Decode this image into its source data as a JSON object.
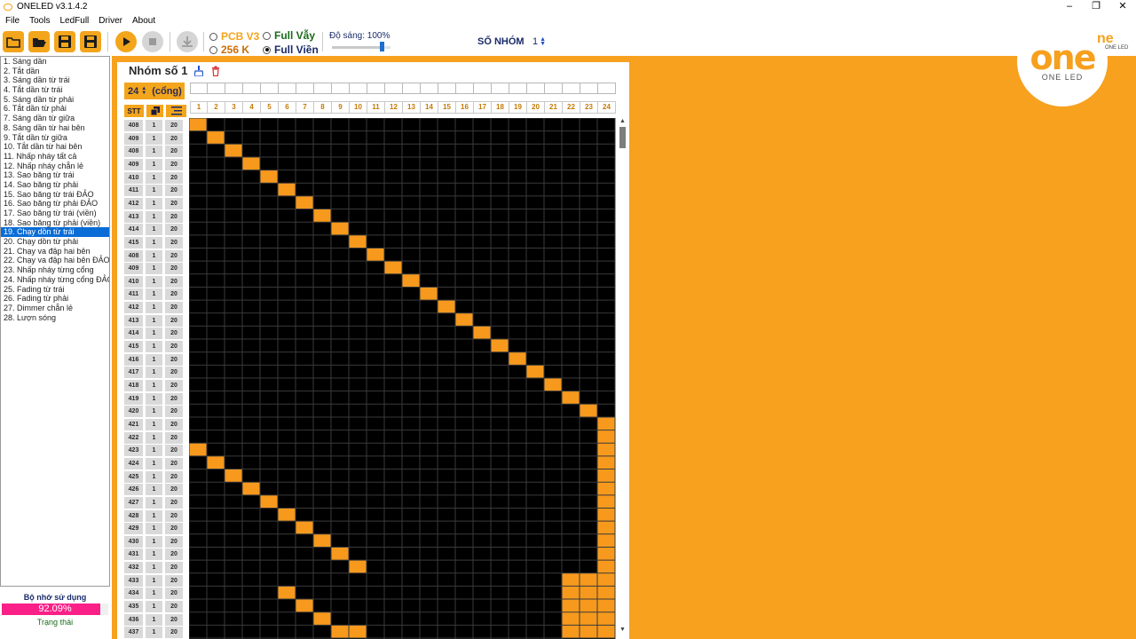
{
  "window": {
    "title": "ONELED v3.1.4.2",
    "controls": [
      "–",
      "❐",
      "✕"
    ]
  },
  "menu": [
    "File",
    "Tools",
    "LedFull",
    "Driver",
    "About"
  ],
  "toolbar": {
    "buttons": [
      "new-folder",
      "open-folder",
      "save",
      "save-as",
      "play",
      "stop",
      "download"
    ],
    "pcb_label": "PCB V3",
    "k256_label": "256 K",
    "full_vay_label": "Full Vẫy",
    "full_vien_label": "Full Viền",
    "selected_mode": "Full Viền",
    "brightness_label": "Độ sáng: 100%",
    "brightness_level": 0.85,
    "group_count_label": "SỐ NHÓM",
    "group_count_value": "1"
  },
  "effects": [
    "1.  Sáng dần",
    "2.  Tắt dần",
    "3.  Sáng dần từ trái",
    "4.  Tắt dần từ trái",
    "5.  Sáng dần từ phải",
    "6.  Tắt dần từ phải",
    "7.  Sáng dần từ giữa",
    "8.  Sáng dần từ hai bên",
    "9.  Tắt dần từ giữa",
    "10. Tắt dần từ hai bên",
    "11. Nhấp nháy tất cả",
    "12. Nhấp nháy chẵn lẻ",
    "13. Sao băng từ trái",
    "14. Sao băng từ phải",
    "15. Sao băng từ trái ĐẢO",
    "16. Sao băng từ phải ĐẢO",
    "17. Sao băng từ trái (viền)",
    "18. Sao băng từ phải (viền)",
    "19. Chạy dồn từ trái",
    "20. Chạy dồn từ phải",
    "21. Chạy va đập hai bên",
    "22. Chạy va đập hai bên ĐẢO",
    "23. Nhấp nháy từng cổng",
    "24. Nhấp nháy từng cổng ĐẢO",
    "25. Fading từ trái",
    "26. Fading từ phải",
    "27. Dimmer chẵn lẻ",
    "28. Lượn sóng"
  ],
  "selected_effect_index": 18,
  "memory": {
    "label": "Bộ nhớ sử dụng",
    "value": "92.09%",
    "fraction": 0.9209,
    "status_label": "Trạng thái"
  },
  "editor": {
    "group_title": "Nhóm số 1",
    "port_count": "24",
    "port_unit": "(cổng)",
    "header_stt": "STT",
    "columns": [
      "1",
      "2",
      "3",
      "4",
      "5",
      "6",
      "7",
      "8",
      "9",
      "10",
      "11",
      "12",
      "13",
      "14",
      "15",
      "16",
      "17",
      "18",
      "19",
      "20",
      "21",
      "22",
      "23",
      "24"
    ],
    "rows": [
      [
        "408",
        "1",
        "20"
      ],
      [
        "409",
        "1",
        "20"
      ],
      [
        "408",
        "1",
        "20"
      ],
      [
        "409",
        "1",
        "20"
      ],
      [
        "410",
        "1",
        "20"
      ],
      [
        "411",
        "1",
        "20"
      ],
      [
        "412",
        "1",
        "20"
      ],
      [
        "413",
        "1",
        "20"
      ],
      [
        "414",
        "1",
        "20"
      ],
      [
        "415",
        "1",
        "20"
      ],
      [
        "408",
        "1",
        "20"
      ],
      [
        "409",
        "1",
        "20"
      ],
      [
        "410",
        "1",
        "20"
      ],
      [
        "411",
        "1",
        "20"
      ],
      [
        "412",
        "1",
        "20"
      ],
      [
        "413",
        "1",
        "20"
      ],
      [
        "414",
        "1",
        "20"
      ],
      [
        "415",
        "1",
        "20"
      ],
      [
        "416",
        "1",
        "20"
      ],
      [
        "417",
        "1",
        "20"
      ],
      [
        "418",
        "1",
        "20"
      ],
      [
        "419",
        "1",
        "20"
      ],
      [
        "420",
        "1",
        "20"
      ],
      [
        "421",
        "1",
        "20"
      ],
      [
        "422",
        "1",
        "20"
      ],
      [
        "423",
        "1",
        "20"
      ],
      [
        "424",
        "1",
        "20"
      ],
      [
        "425",
        "1",
        "20"
      ],
      [
        "426",
        "1",
        "20"
      ],
      [
        "427",
        "1",
        "20"
      ],
      [
        "428",
        "1",
        "20"
      ],
      [
        "429",
        "1",
        "20"
      ],
      [
        "430",
        "1",
        "20"
      ],
      [
        "431",
        "1",
        "20"
      ],
      [
        "432",
        "1",
        "20"
      ],
      [
        "433",
        "1",
        "20"
      ],
      [
        "434",
        "1",
        "20"
      ],
      [
        "435",
        "1",
        "20"
      ],
      [
        "436",
        "1",
        "20"
      ],
      [
        "437",
        "1",
        "20"
      ]
    ],
    "lit": [
      [
        1
      ],
      [
        2
      ],
      [
        3
      ],
      [
        4
      ],
      [
        5
      ],
      [
        6
      ],
      [
        7
      ],
      [
        8
      ],
      [
        9
      ],
      [
        10
      ],
      [
        11
      ],
      [
        12
      ],
      [
        13
      ],
      [
        14
      ],
      [
        15
      ],
      [
        16
      ],
      [
        17
      ],
      [
        18
      ],
      [
        19
      ],
      [
        20
      ],
      [
        21
      ],
      [
        22
      ],
      [
        23
      ],
      [
        24
      ],
      [
        24
      ],
      [
        1,
        24
      ],
      [
        2,
        24
      ],
      [
        3,
        24
      ],
      [
        4,
        24
      ],
      [
        5,
        24
      ],
      [
        6,
        24
      ],
      [
        7,
        24
      ],
      [
        8,
        24
      ],
      [
        9,
        24
      ],
      [
        10,
        24
      ],
      [
        22,
        23,
        24
      ],
      [
        6,
        22,
        23,
        24
      ],
      [
        7,
        22,
        23,
        24
      ],
      [
        8,
        22,
        23,
        24
      ],
      [
        9,
        10,
        22,
        23,
        24
      ]
    ],
    "colors": {
      "lit": "#f7991c",
      "off": "#000000",
      "grid": "#3a3a3a"
    }
  },
  "logo": {
    "mark": "one",
    "caption": "ONE LED",
    "fragment": "ne",
    "fragment_caption": "ONE LED"
  }
}
